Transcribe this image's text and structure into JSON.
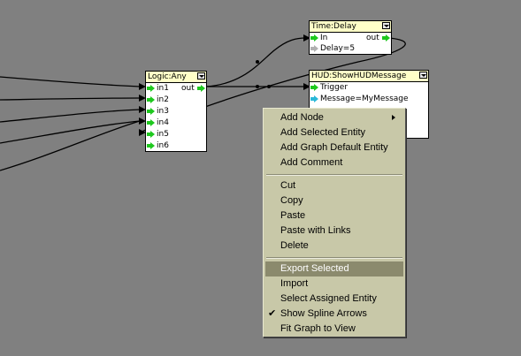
{
  "nodes": {
    "logic_any": {
      "title": "Logic:Any",
      "inputs": [
        "in1",
        "in2",
        "in3",
        "in4",
        "in5",
        "in6"
      ],
      "output": "out"
    },
    "time_delay": {
      "title": "Time:Delay",
      "input": "In",
      "output": "out",
      "delay": "Delay=5"
    },
    "hud": {
      "title": "HUD:ShowHUDMessage",
      "trigger": "Trigger",
      "message": "Message=MyMessage"
    }
  },
  "context_menu": {
    "items": [
      {
        "label": "Add Node",
        "submenu": true
      },
      {
        "label": "Add Selected Entity"
      },
      {
        "label": "Add Graph Default Entity"
      },
      {
        "label": "Add Comment"
      },
      {
        "label": "Cut"
      },
      {
        "label": "Copy"
      },
      {
        "label": "Paste"
      },
      {
        "label": "Paste with Links"
      },
      {
        "label": "Delete"
      },
      {
        "label": "Export Selected",
        "highlighted": true
      },
      {
        "label": "Import"
      },
      {
        "label": "Select Assigned Entity"
      },
      {
        "label": "Show Spline Arrows",
        "checked": true
      },
      {
        "label": "Fit Graph to View"
      }
    ]
  },
  "colors": {
    "canvas": "#808080",
    "node_title": "#ffffc8",
    "port_arrow": "#1ec81e",
    "menu_bg": "#c8c8a8",
    "menu_highlight": "#8b8a6d"
  }
}
